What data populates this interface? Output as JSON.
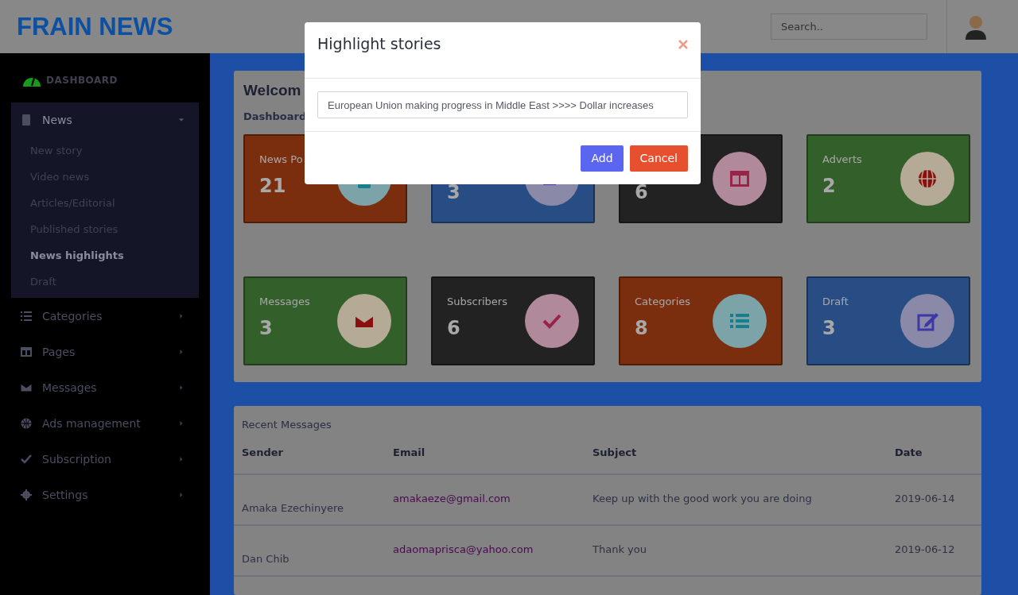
{
  "header": {
    "logo": "FRAIN NEWS",
    "search": {
      "placeholder": "Search.."
    }
  },
  "sidebar": {
    "dashboard": "DASHBOARD",
    "items": [
      {
        "label": "News",
        "expanded": true,
        "children": [
          {
            "label": "New story",
            "selected": false
          },
          {
            "label": "Video news",
            "selected": false
          },
          {
            "label": "Articles/Editorial",
            "selected": false
          },
          {
            "label": "Published stories",
            "selected": false
          },
          {
            "label": "News highlights",
            "selected": true
          },
          {
            "label": "Draft",
            "selected": false
          }
        ]
      },
      {
        "label": "Categories",
        "expanded": false
      },
      {
        "label": "Pages",
        "expanded": false
      },
      {
        "label": "Messages",
        "expanded": false
      },
      {
        "label": "Ads management",
        "expanded": false
      },
      {
        "label": "Subscription",
        "expanded": false
      },
      {
        "label": "Settings",
        "expanded": false
      }
    ]
  },
  "overview": {
    "title": "Welcom",
    "breadcrumb": "Dashboard",
    "cards": [
      {
        "label": "News Po",
        "value": "21",
        "color": "#7a2e0e"
      },
      {
        "value": "3",
        "color": "#284d84"
      },
      {
        "value": "6",
        "color": "#222222"
      },
      {
        "label": "Adverts",
        "value": "2",
        "color": "#335f2a"
      },
      {
        "label": "Messages",
        "value": "3",
        "color": "#335f2a"
      },
      {
        "label": "Subscribers",
        "value": "6",
        "color": "#222222"
      },
      {
        "label": "Categories",
        "value": "8",
        "color": "#7a2e0e"
      },
      {
        "label": "Draft",
        "value": "3",
        "color": "#284d84"
      }
    ]
  },
  "recent_messages": {
    "title": "Recent Messages",
    "columns": [
      "Sender",
      "Email",
      "Subject",
      "Date"
    ],
    "rows": [
      {
        "sender": "Amaka Ezechinyere",
        "email": "amakaeze@gmail.com",
        "subject": "Keep up with the good work you are doing",
        "date": "2019-06-14"
      },
      {
        "sender": "Dan Chib",
        "email": "adaomaprisca@yahoo.com",
        "subject": "Thank you",
        "date": "2019-06-12"
      }
    ]
  },
  "modal": {
    "title": "Highlight stories",
    "value": "European Union making progress in Middle East >>>> Dollar increases",
    "buttons": [
      {
        "label": "Add",
        "kind": "primary"
      },
      {
        "label": "Cancel",
        "kind": "danger"
      }
    ]
  }
}
